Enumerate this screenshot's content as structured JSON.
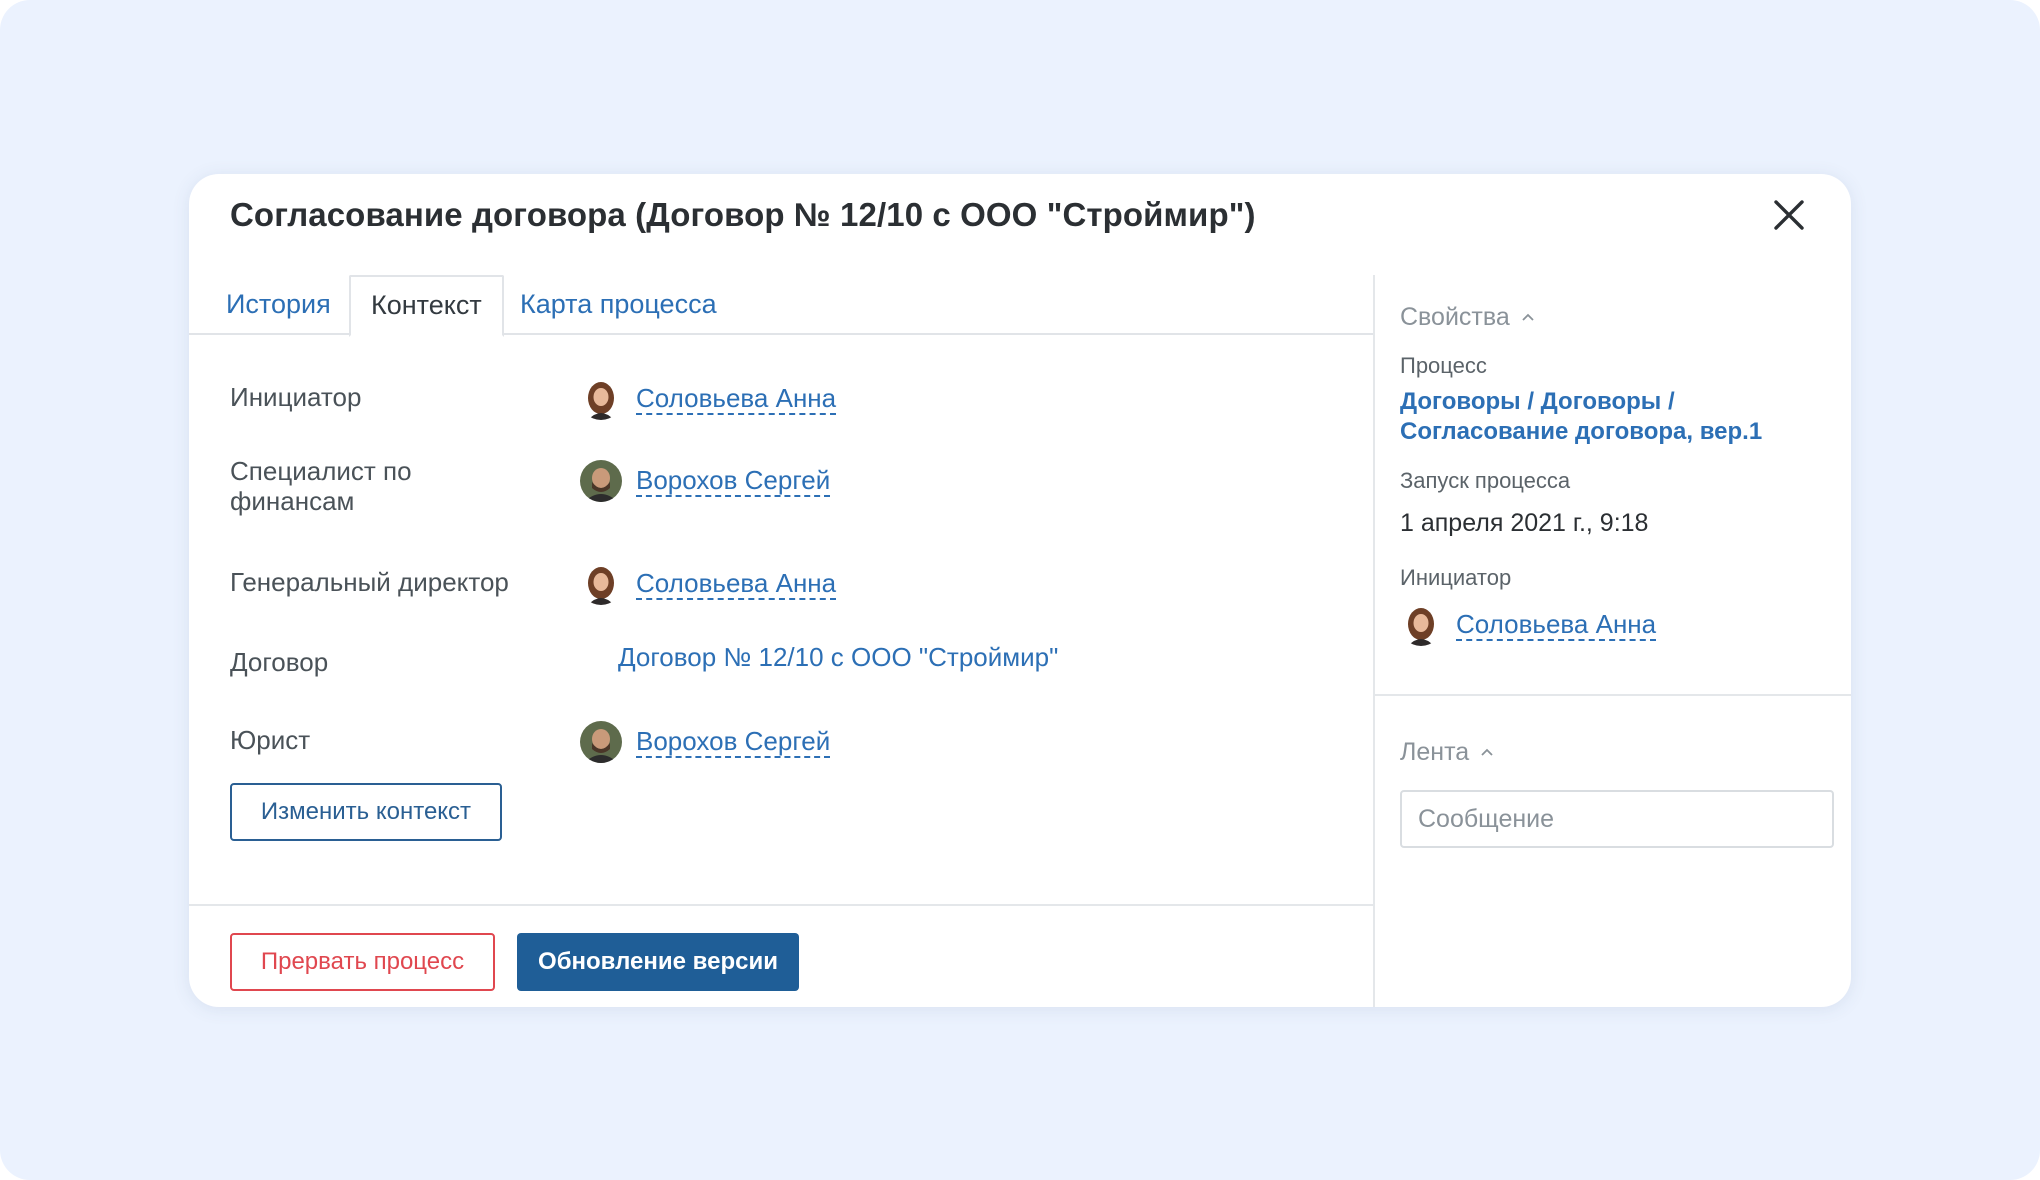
{
  "modal": {
    "title": "Согласование договора (Договор № 12/10 с ООО \"Строймир\")"
  },
  "tabs": [
    {
      "label": "История",
      "active": false
    },
    {
      "label": "Контекст",
      "active": true
    },
    {
      "label": "Карта процесса",
      "active": false
    }
  ],
  "context": {
    "initiator_label": "Инициатор",
    "initiator_name": "Соловьева Анна",
    "finance_label": "Специалист по финансам",
    "finance_name": "Ворохов Сергей",
    "ceo_label": "Генеральный директор",
    "ceo_name": "Соловьева Анна",
    "contract_label": "Договор",
    "contract_value": "Договор № 12/10 с ООО \"Строймир\"",
    "lawyer_label": "Юрист",
    "lawyer_name": "Ворохов Сергей",
    "change_button": "Изменить контекст"
  },
  "footer": {
    "abort_button": "Прервать процесс",
    "update_button": "Обновление версии"
  },
  "properties": {
    "header": "Свойства",
    "process_label": "Процесс",
    "process_value": "Договоры / Договоры / Согласование договора, вер.1",
    "start_label": "Запуск процесса",
    "start_value": "1 апреля 2021 г., 9:18",
    "initiator_label": "Инициатор",
    "initiator_name": "Соловьева Анна"
  },
  "feed": {
    "header": "Лента",
    "message_placeholder": "Сообщение"
  },
  "colors": {
    "background": "#ebf2fe",
    "link": "#2c6fb5",
    "primary": "#1f5e97",
    "danger": "#e0474f"
  }
}
